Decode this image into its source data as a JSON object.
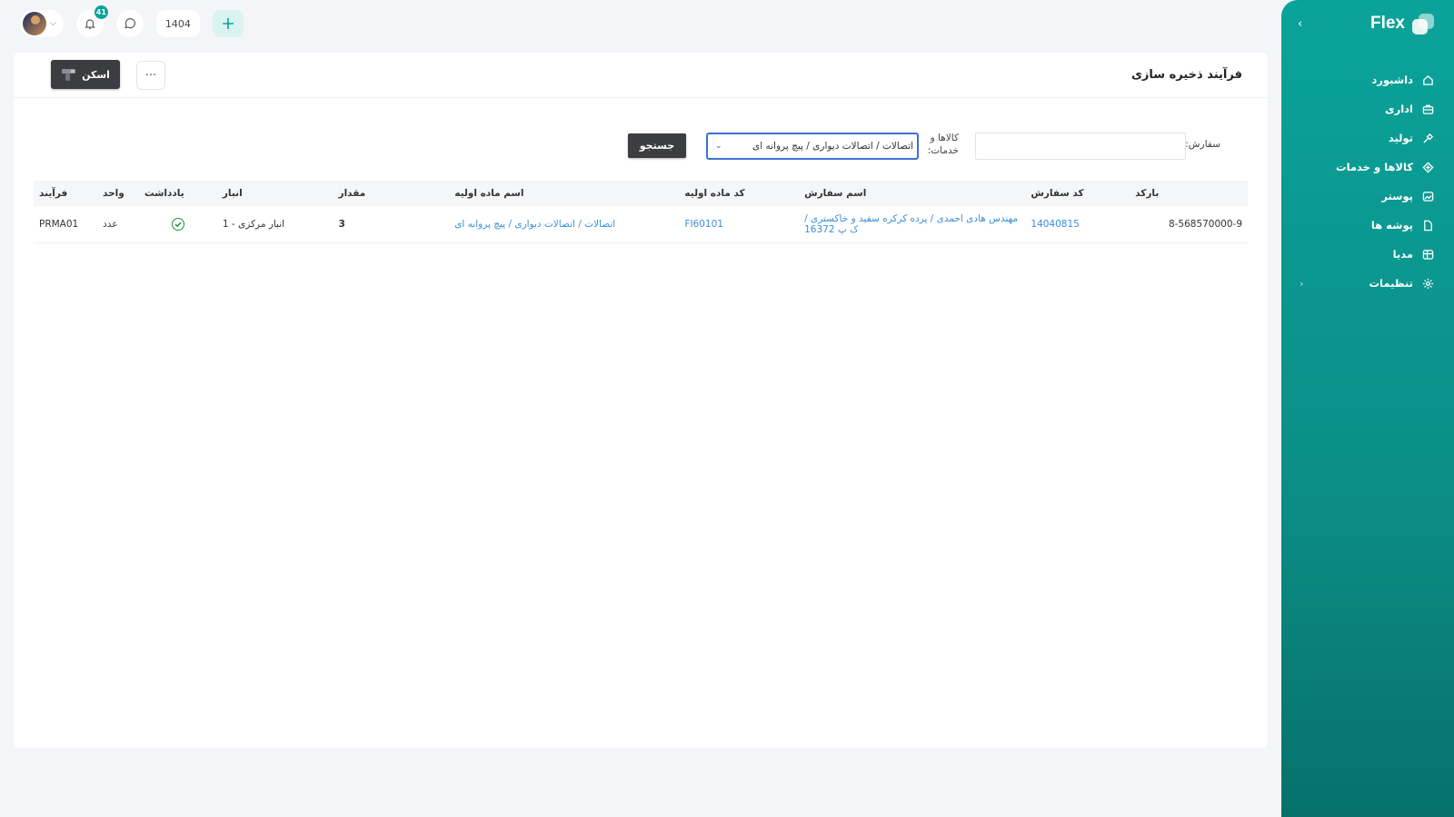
{
  "sidebar": {
    "brand": "Flex",
    "items": [
      {
        "label": "داشبورد",
        "icon": "home-icon"
      },
      {
        "label": "اداری",
        "icon": "briefcase-icon"
      },
      {
        "label": "تولید",
        "icon": "tools-icon"
      },
      {
        "label": "کالاها و خدمات",
        "icon": "box-icon"
      },
      {
        "label": "پوستر",
        "icon": "image-icon"
      },
      {
        "label": "پوشه ها",
        "icon": "folder-icon"
      },
      {
        "label": "مدیا",
        "icon": "media-icon"
      },
      {
        "label": "تنظیمات",
        "icon": "gear-icon"
      }
    ]
  },
  "topbar": {
    "notifications_count": "41",
    "year": "1404"
  },
  "page": {
    "title": "فرآیند ذخیره سازی",
    "scan_label": "اسکن",
    "more_label": "···"
  },
  "filters": {
    "order_label": "سفارش:",
    "order_value": "",
    "goods_label": "کالاها و خدمات:",
    "goods_value": "اتصالات / اتصالات دیواری / پیچ پروانه ای",
    "search_label": "جستجو"
  },
  "table": {
    "headers": [
      "بارکد",
      "کد سفارش",
      "اسم سفارش",
      "کد ماده اولیه",
      "اسم ماده اولیه",
      "مقدار",
      "انبار",
      "یادداشت",
      "واحد",
      "فرآیند"
    ],
    "rows": [
      {
        "barcode": "8-568570000-9",
        "order_code": "14040815",
        "order_name": "مهندس هادی احمدی / پرده کرکره سفید و خاکستری / ک پ 16372",
        "material_code": "FI60101",
        "material_name": "اتصالات / اتصالات دیواری / پیچ پروانه ای",
        "quantity": "3",
        "store": "انبار مرکزی - 1",
        "note": "check-icon",
        "unit": "عدد",
        "process": "PRMA01"
      }
    ]
  },
  "colors": {
    "accent": "#0aa39a",
    "dark_button": "#3b3d40",
    "link": "#3a8fd6",
    "success": "#1e8f3e"
  }
}
